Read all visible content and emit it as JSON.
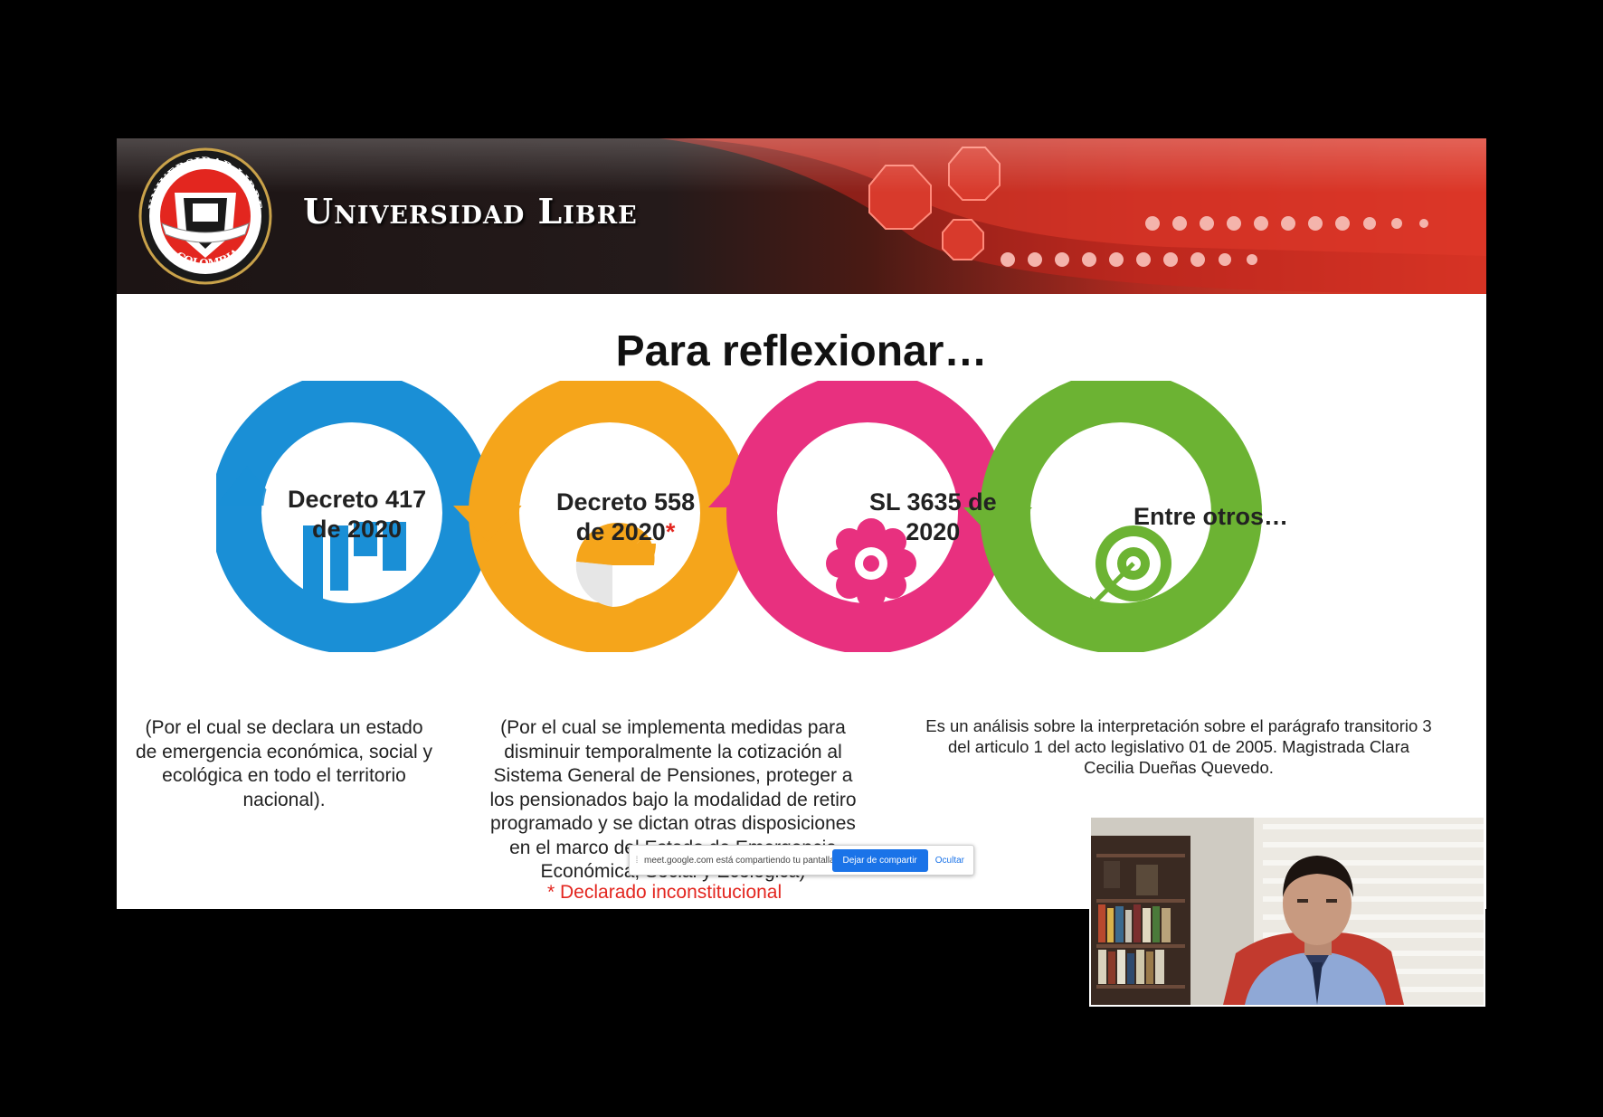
{
  "slide": {
    "banner_title": "Universidad Libre",
    "logo_text": {
      "top": "UNIVERSIDAD LIBRE",
      "bottom": "COLOMBIA"
    },
    "title": "Para reflexionar…",
    "nodes": [
      {
        "label_line1": "Decreto 417",
        "label_line2": "de 2020",
        "color": "#1a8fd6",
        "icon": "bar-chart-icon"
      },
      {
        "label_line1": "Decreto 558",
        "label_line2": "de 2020",
        "star": "*",
        "color": "#f5a51b",
        "icon": "pie-chart-icon"
      },
      {
        "label_line1": "SL 3635 de",
        "label_line2": "2020",
        "color": "#e8307f",
        "icon": "gear-icon"
      },
      {
        "label_line1": "Entre otros…",
        "label_line2": "",
        "color": "#6cb333",
        "icon": "target-icon"
      }
    ],
    "descriptions": [
      [
        "(Por el cual se declara un estado",
        "de emergencia económica, social y",
        "ecológica en todo el territorio",
        "nacional)."
      ],
      [
        "(Por el cual se implementa medidas para",
        "disminuir temporalmente la cotización al",
        "Sistema General de Pensiones, proteger a",
        "los pensionados bajo la modalidad de retiro",
        "programado y se dictan otras disposiciones",
        "en el marco del Estado de Emergencia",
        "Económica, Social y Ecológica)"
      ],
      [
        "Es un análisis sobre la interpretación sobre el parágrafo transitorio 3",
        "del articulo 1 del acto legislativo 01 de 2005. Magistrada Clara",
        "Cecilia Dueñas Quevedo."
      ]
    ],
    "red_note": "* Declarado inconstitucional"
  },
  "share_bar": {
    "message": "meet.google.com está compartiendo tu pantalla.",
    "stop_label": "Dejar de compartir",
    "hide_label": "Ocultar"
  },
  "colors": {
    "blue": "#1a8fd6",
    "orange": "#f5a51b",
    "pink": "#e8307f",
    "green": "#6cb333",
    "red": "#e3261f"
  }
}
